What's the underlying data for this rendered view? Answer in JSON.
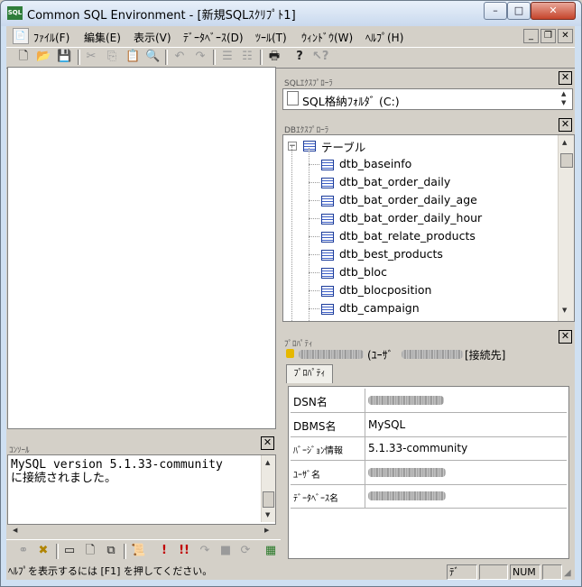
{
  "window": {
    "title": "Common SQL Environment - [新規SQLｽｸﾘﾌﾟﾄ1]",
    "app_icon_text": "SQL",
    "controls": {
      "minimize": "–",
      "maximize": "□",
      "close": "✕"
    }
  },
  "menu": {
    "items": [
      "ﾌｧｲﾙ(F)",
      "編集(E)",
      "表示(V)",
      "ﾃﾞｰﾀﾍﾞｰｽ(D)",
      "ﾂｰﾙ(T)",
      "ｳｨﾝﾄﾞｳ(W)",
      "ﾍﾙﾌﾟ(H)"
    ],
    "mdi_controls": {
      "minimize": "_",
      "restore": "❐",
      "close": "✕"
    }
  },
  "toolbar": {
    "icons": [
      "new-file-icon",
      "open-folder-icon",
      "save-icon",
      "cut-icon",
      "copy-icon",
      "paste-icon",
      "find-icon",
      "undo-icon",
      "redo-icon",
      "indent-icon",
      "outdent-icon",
      "print-icon",
      "help-icon",
      "context-help-icon"
    ]
  },
  "sql_explorer": {
    "title": "SQLｴｸｽﾌﾟﾛｰﾗ",
    "folder_label": "SQL格納ﾌｫﾙﾀﾞ (C:)"
  },
  "db_explorer": {
    "title": "DBｴｸｽﾌﾟﾛｰﾗ",
    "root_label": "テーブル",
    "tables": [
      "dtb_baseinfo",
      "dtb_bat_order_daily",
      "dtb_bat_order_daily_age",
      "dtb_bat_order_daily_hour",
      "dtb_bat_relate_products",
      "dtb_best_products",
      "dtb_bloc",
      "dtb_blocposition",
      "dtb_campaign"
    ]
  },
  "properties": {
    "title": "ﾌﾟﾛﾊﾟﾃｨ",
    "connection_user_label": "(ﾕｰｻﾞ",
    "connection_suffix": "[接続先]",
    "tab_label": "ﾌﾟﾛﾊﾟﾃｨ",
    "rows": [
      {
        "key": "DSN名",
        "value": ""
      },
      {
        "key": "DBMS名",
        "value": "MySQL"
      },
      {
        "key": "ﾊﾞｰｼﾞｮﾝ情報",
        "value": "5.1.33-community"
      },
      {
        "key": "ﾕｰｻﾞ名",
        "value": ""
      },
      {
        "key": "ﾃﾞｰﾀﾍﾞｰｽ名",
        "value": ""
      }
    ]
  },
  "console": {
    "title": "ｺﾝｿｰﾙ",
    "lines": [
      "MySQL version 5.1.33-community",
      "に接続されました。"
    ]
  },
  "bottom_toolbar": {
    "icons": [
      "connect-icon",
      "disconnect-icon",
      "window-icon",
      "new-doc-icon",
      "tile-icon",
      "script-icon",
      "execute-icon",
      "execute-all-icon",
      "step-icon",
      "stop-icon",
      "commit-icon"
    ]
  },
  "status": {
    "message": "ﾍﾙﾌﾟを表示するには [F1] を押してください。",
    "indicator_1": "ﾃﾞ",
    "num": "NUM"
  }
}
